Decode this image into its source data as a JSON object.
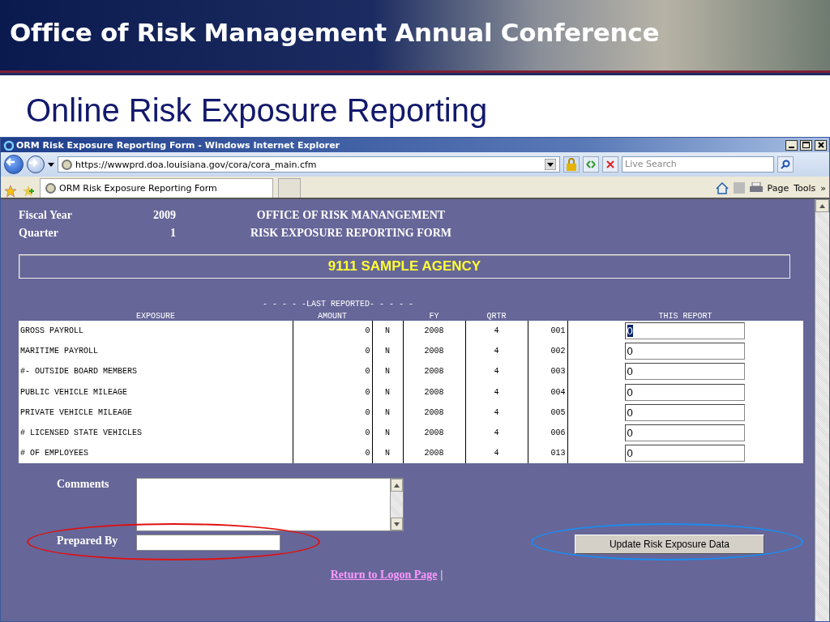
{
  "slide": {
    "title": "Office of Risk Management Annual Conference",
    "subtitle": "Online Risk Exposure Reporting"
  },
  "browser": {
    "title": "ORM Risk Exposure Reporting Form - Windows Internet Explorer",
    "address": "https://wwwprd.doa.louisiana.gov/cora/cora_main.cfm",
    "search_placeholder": "Live Search",
    "tab_title": "ORM Risk Exposure Reporting Form",
    "menus": [
      "Page",
      "Tools"
    ],
    "overflow": "»"
  },
  "form": {
    "header": [
      {
        "label": "Fiscal Year",
        "value": "2009"
      },
      {
        "label": "Quarter",
        "value": "1"
      }
    ],
    "org_lines": [
      "OFFICE OF RISK MANANGEMENT",
      "RISK EXPOSURE REPORTING FORM"
    ],
    "agency": "9111  SAMPLE AGENCY",
    "group_heading": "- - - - -LAST REPORTED- - - - -",
    "columns": [
      "EXPOSURE",
      "AMOUNT",
      "FY",
      "QRTR",
      "THIS REPORT"
    ],
    "rows": [
      {
        "exposure": "GROSS PAYROLL",
        "amount": "0",
        "flag": "N",
        "fy": "2008",
        "qrtr": "4",
        "code": "001",
        "value": "0",
        "selected": true
      },
      {
        "exposure": "MARITIME PAYROLL",
        "amount": "0",
        "flag": "N",
        "fy": "2008",
        "qrtr": "4",
        "code": "002",
        "value": "0",
        "selected": false
      },
      {
        "exposure": "#- OUTSIDE BOARD MEMBERS",
        "amount": "0",
        "flag": "N",
        "fy": "2008",
        "qrtr": "4",
        "code": "003",
        "value": "0",
        "selected": false
      },
      {
        "exposure": "PUBLIC VEHICLE MILEAGE",
        "amount": "0",
        "flag": "N",
        "fy": "2008",
        "qrtr": "4",
        "code": "004",
        "value": "0",
        "selected": false
      },
      {
        "exposure": "PRIVATE VEHICLE MILEAGE",
        "amount": "0",
        "flag": "N",
        "fy": "2008",
        "qrtr": "4",
        "code": "005",
        "value": "0",
        "selected": false
      },
      {
        "exposure": "# LICENSED STATE VEHICLES",
        "amount": "0",
        "flag": "N",
        "fy": "2008",
        "qrtr": "4",
        "code": "006",
        "value": "0",
        "selected": false
      },
      {
        "exposure": "# OF EMPLOYEES",
        "amount": "0",
        "flag": "N",
        "fy": "2008",
        "qrtr": "4",
        "code": "013",
        "value": "0",
        "selected": false
      }
    ],
    "comments_label": "Comments",
    "prepared_by_label": "Prepared By",
    "submit": "Update Risk Exposure Data",
    "link": "Return to Logon Page",
    "link_separator": "|"
  }
}
